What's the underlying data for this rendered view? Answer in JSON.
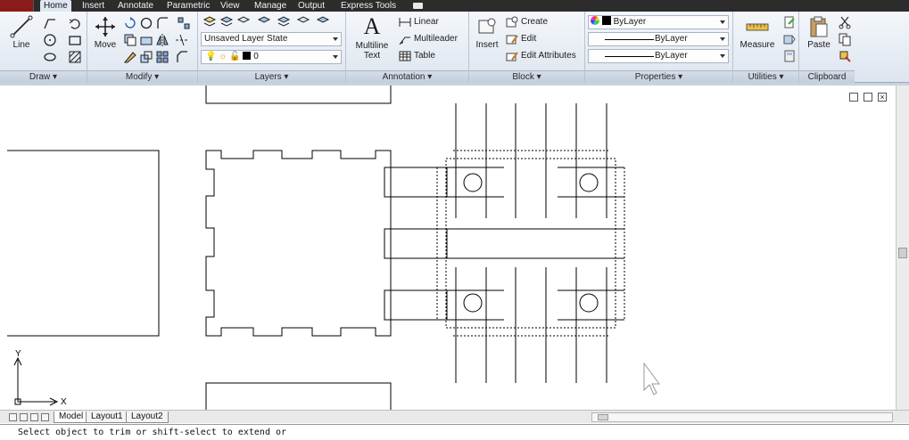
{
  "tabs": [
    "Home",
    "Insert",
    "Annotate",
    "Parametric",
    "View",
    "Manage",
    "Output",
    "Express Tools"
  ],
  "active_tab": "Home",
  "panels": {
    "draw": {
      "title": "Draw",
      "line_label": "Line"
    },
    "modify": {
      "title": "Modify",
      "move_label": "Move"
    },
    "layers": {
      "title": "Layers",
      "layer_state": "Unsaved Layer State",
      "current_layer": "0"
    },
    "annotation": {
      "title": "Annotation",
      "multiline_text_label": "Multiline Text",
      "linear": "Linear",
      "multileader": "Multileader",
      "table": "Table"
    },
    "block": {
      "title": "Block",
      "insert": "Insert",
      "create": "Create",
      "edit": "Edit",
      "edit_attributes": "Edit Attributes"
    },
    "properties": {
      "title": "Properties",
      "color": "ByLayer",
      "linetype": "ByLayer",
      "lineweight": "ByLayer"
    },
    "utilities": {
      "title": "Utilities",
      "measure": "Measure"
    },
    "clipboard": {
      "title": "Clipboard",
      "paste": "Paste"
    }
  },
  "layout_tabs": [
    "Model",
    "Layout1",
    "Layout2"
  ],
  "active_layout": "Model",
  "ucs": {
    "x_label": "X",
    "y_label": "Y"
  },
  "command_line": "Select object to trim or shift-select to extend or",
  "colors": {
    "tabbar": "#2c2c2c",
    "accent": "#8b1a1a",
    "ribbon_bg": "#e7edf5"
  }
}
